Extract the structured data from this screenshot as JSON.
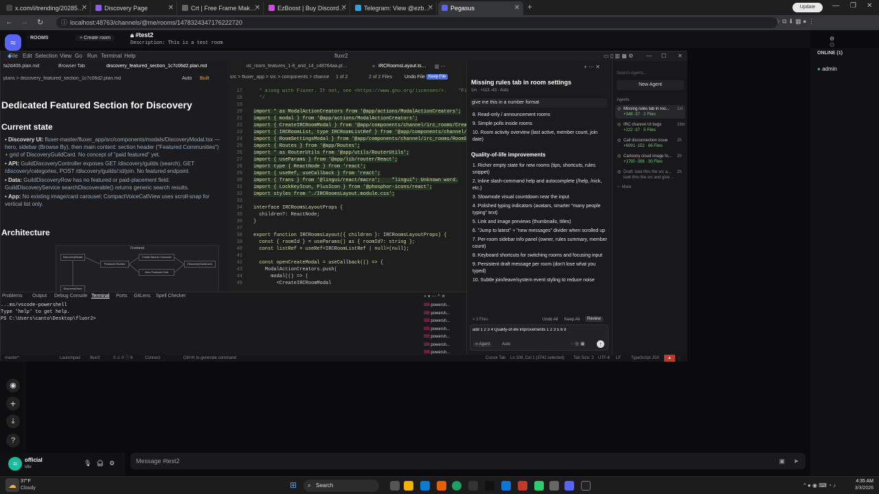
{
  "browser": {
    "tabs": [
      {
        "label": "x.com/i/trending/2028597352...",
        "fav": "#444"
      },
      {
        "label": "Discovery Page",
        "fav": "#8a5cf6"
      },
      {
        "label": "Crt | Free Frame Maker | Creat...",
        "fav": "#666"
      },
      {
        "label": "EzBoost | Buy Discord Boosts &...",
        "fav": "#d946ef"
      },
      {
        "label": "Telegram: View @ezboostdc",
        "fav": "#2aa3e0"
      },
      {
        "label": "Pegasus",
        "fav": "#5865f2"
      }
    ],
    "url": "localhost:48763/channels/@me/rooms/1478324347176222720",
    "update_label": "Update"
  },
  "discord": {
    "section_label": "ROOMS",
    "create_room": "+ Create room",
    "channel_name": "#test2",
    "channel_description": "Description: This is a test room",
    "online_header": "ONLINE (1)",
    "online_member": "admin",
    "message_placeholder": "Message #test2",
    "user_name": "official",
    "user_status": "Idle"
  },
  "vscode": {
    "menu": [
      "File",
      "Edit",
      "Selection",
      "View",
      "Go",
      "Run",
      "Terminal",
      "Help"
    ],
    "window_title": "fluxr2",
    "editor_tabs": [
      "fa2d406.plan.md",
      "Browser Tab",
      "discovery_featured_section_1c7c06d2.plan.md",
      "irc_room_features_1-8_and_14_c48764aa.plan.md",
      "IRCRoomsLayout.tsx U"
    ],
    "plan_breadcrumb": "plans > discovery_featured_section_1c7c06d2.plan.md",
    "plan_mode": "Auto",
    "plan_build": "Built",
    "code_breadcrumb": "src > fluxer_app > src > components > channe",
    "code_nav": "1 of 2",
    "code_files": "2 of 2 Files",
    "undo_file": "Undo File",
    "keep_file": "Keep File",
    "doc": {
      "title": "Dedicated Featured Section for Discovery",
      "current_state_heading": "Current state",
      "bullets": [
        {
          "label": "Discovery UI:",
          "text": "fluxer-master/fluxer_app/src/components/modals/DiscoveryModal.tsx — hero, sidebar (Browse By), then main content: section header (\"Featured Communities\") + grid of DiscoveryGuildCard. No concept of \"paid featured\" yet."
        },
        {
          "label": "API:",
          "text": "GuildDiscoveryController exposes GET /discovery/guilds (search), GET /discovery/categories, POST /discovery/guilds/:id/join. No featured endpoint."
        },
        {
          "label": "Data:",
          "text": "GuildDiscoveryRow has no featured or paid-placement field. GuildDiscoveryService searchDiscoverable() returns generic search results."
        },
        {
          "label": "App:",
          "text": "No existing image/card carousel; CompactVoiceCallView uses scroll-snap for vertical list only."
        }
      ],
      "architecture_heading": "Architecture",
      "diagram": {
        "title": "Frontend",
        "nodes": [
          "DiscoveryModal",
          "Featured Section",
          "3 slide Banner Carousel",
          "Hero Featured Grid",
          "DiscoveryGuildCard",
          "DiscoveryStore"
        ]
      }
    },
    "code_lines": [
      {
        "n": "17",
        "t": "  * along with Fluxer. If not, see <https://www.gnu.org/licenses/>.    \"Flux"
      },
      {
        "n": "18",
        "t": "  */"
      },
      {
        "n": "19",
        "t": ""
      },
      {
        "n": "20",
        "t": "import * as ModalActionCreators from '@app/actions/ModalActionCreators';"
      },
      {
        "n": "21",
        "t": "import { modal } from '@app/actions/ModalActionCreators';"
      },
      {
        "n": "22",
        "t": "import { CreateIRCRoomModal } from '@app/components/channel/irc_rooms/Creat"
      },
      {
        "n": "23",
        "t": "import { IRCRoomList, type IRCRoomListRef } from '@app/components/channel/i"
      },
      {
        "n": "24",
        "t": "import { RoomSettingsModal } from '@app/components/channel/irc_rooms/RoomSe"
      },
      {
        "n": "25",
        "t": "import { Routes } from '@app/Routes';"
      },
      {
        "n": "26",
        "t": "import * as RouterUtils from '@app/utils/RouterUtils';"
      },
      {
        "n": "27",
        "t": "import { useParams } from '@app/lib/router/React';"
      },
      {
        "n": "28",
        "t": "import type { ReactNode } from 'react';"
      },
      {
        "n": "29",
        "t": "import { useRef, useCallback } from 'react';"
      },
      {
        "n": "30",
        "t": "import { Trans } from '@lingui/react/macro';    \"lingui\": Unknown word."
      },
      {
        "n": "31",
        "t": "import { LockKeyIcon, PlusIcon } from '@phosphor-icons/react';"
      },
      {
        "n": "32",
        "t": "import styles from './IRCRoomsLayout.module.css';"
      },
      {
        "n": "33",
        "t": ""
      },
      {
        "n": "34",
        "t": "interface IRCRoomsLayoutProps {"
      },
      {
        "n": "35",
        "t": "  children?: ReactNode;"
      },
      {
        "n": "36",
        "t": "}"
      },
      {
        "n": "37",
        "t": ""
      },
      {
        "n": "38",
        "t": "export function IRCRoomsLayout({ children }: IRCRoomsLayoutProps) {"
      },
      {
        "n": "39",
        "t": "  const { roomId } = useParams() as { roomId?: string };"
      },
      {
        "n": "40",
        "t": "  const listRef = useRef<IRCRoomListRef | null>(null);"
      },
      {
        "n": "41",
        "t": ""
      },
      {
        "n": "42",
        "t": "  const openCreateModal = useCallback(() => {"
      },
      {
        "n": "43",
        "t": "    ModalActionCreators.push("
      },
      {
        "n": "44",
        "t": "      modal(() => ("
      },
      {
        "n": "45",
        "t": "        <CreateIRCRoomModal"
      }
    ],
    "terminal": {
      "tabs": [
        "Problems",
        "Output",
        "Debug Console",
        "Terminal",
        "Ports",
        "GitLens",
        "Spell Checker"
      ],
      "lines": [
        "...ms/vscode-powershell",
        "Type 'help' to get help.",
        "",
        "PS C:\\Users\\canto\\Desktop\\fluor2>"
      ],
      "sessions": [
        "powersh...",
        "powersh...",
        "powersh...",
        "powersh...",
        "powersh...",
        "powersh...",
        "powersh..."
      ]
    },
    "chat": {
      "title": "Missing rules tab in room settings",
      "meta": "1m · +113 -43 · Auto",
      "user_prompt": "give me this in a number format",
      "top_items": [
        "8. Read-only / announcement rooms",
        "9. Simple polls inside rooms",
        "10. Room activity overview (last active, member count, join date)"
      ],
      "qol_heading": "Quality-of-life improvements",
      "qol_items": [
        "1. Richer empty state for new rooms (tips, shortcuts, rules snippet)",
        "2. Inline slash-command help and autocomplete (/help, /nick, etc.)",
        "3. Slowmode visual countdown near the input",
        "4. Polished typing indicators (avatars, smarter \"many people typing\" text)",
        "5. Link and image previews (thumbnails, titles)",
        "6. \"Jump to latest\" + \"new messages\" divider when scrolled up",
        "7. Per-room sidebar info panel (owner, rules summary, member count)",
        "8. Keyboard shortcuts for switching rooms and focusing input",
        "9. Persistent draft message per room (don't lose what you typed)",
        "10. Subtle join/leave/system event styling to reduce noise"
      ],
      "files_label": "> 3 Files",
      "undo_all": "Undo All",
      "keep_all": "Keep All",
      "review": "Review",
      "input_text": "add 1 2 3 4 Quality-of-life improvements 1 2 3 5 6 9",
      "agent_mode": "Agent",
      "auto_mode": "Auto"
    },
    "agents": {
      "search_placeholder": "Search Agents...",
      "new_agent": "New Agent",
      "header": "Agents",
      "items": [
        {
          "title": "Missing rules tab in roo...",
          "time": "1m",
          "meta": "+348 -37 · 2 Files"
        },
        {
          "title": "IRC channel UI bugs",
          "time": "19m",
          "meta": "+222 -37 · 5 Files"
        },
        {
          "title": "Call disconnection issue",
          "time": "2h",
          "meta": "+6091 -152 · 66 Files"
        },
        {
          "title": "Cartoony cloud image fo...",
          "time": "2h",
          "meta": "+1790 -306 · 30 Files"
        },
        {
          "title": "Draft: look thru the src a... look thru the src and give ...",
          "time": "2h",
          "meta": ""
        }
      ],
      "more": "More"
    },
    "status_left": [
      "master*",
      "Launchpad",
      "fluxr2",
      "0 ⚠ 0 ⓘ 6",
      "Connect"
    ],
    "status_center": "Ctrl+K to generate command",
    "status_right": [
      "Cursor Tab",
      "Ln 109, Col 1 (3742 selected)",
      "Tab Size: 2",
      "UTF-8",
      "LF",
      "TypeScript JSX"
    ]
  },
  "taskbar": {
    "weather_temp": "37°F",
    "weather_desc": "Cloudy",
    "search": "Search",
    "time": "4:35 AM",
    "date": "3/3/2026"
  }
}
